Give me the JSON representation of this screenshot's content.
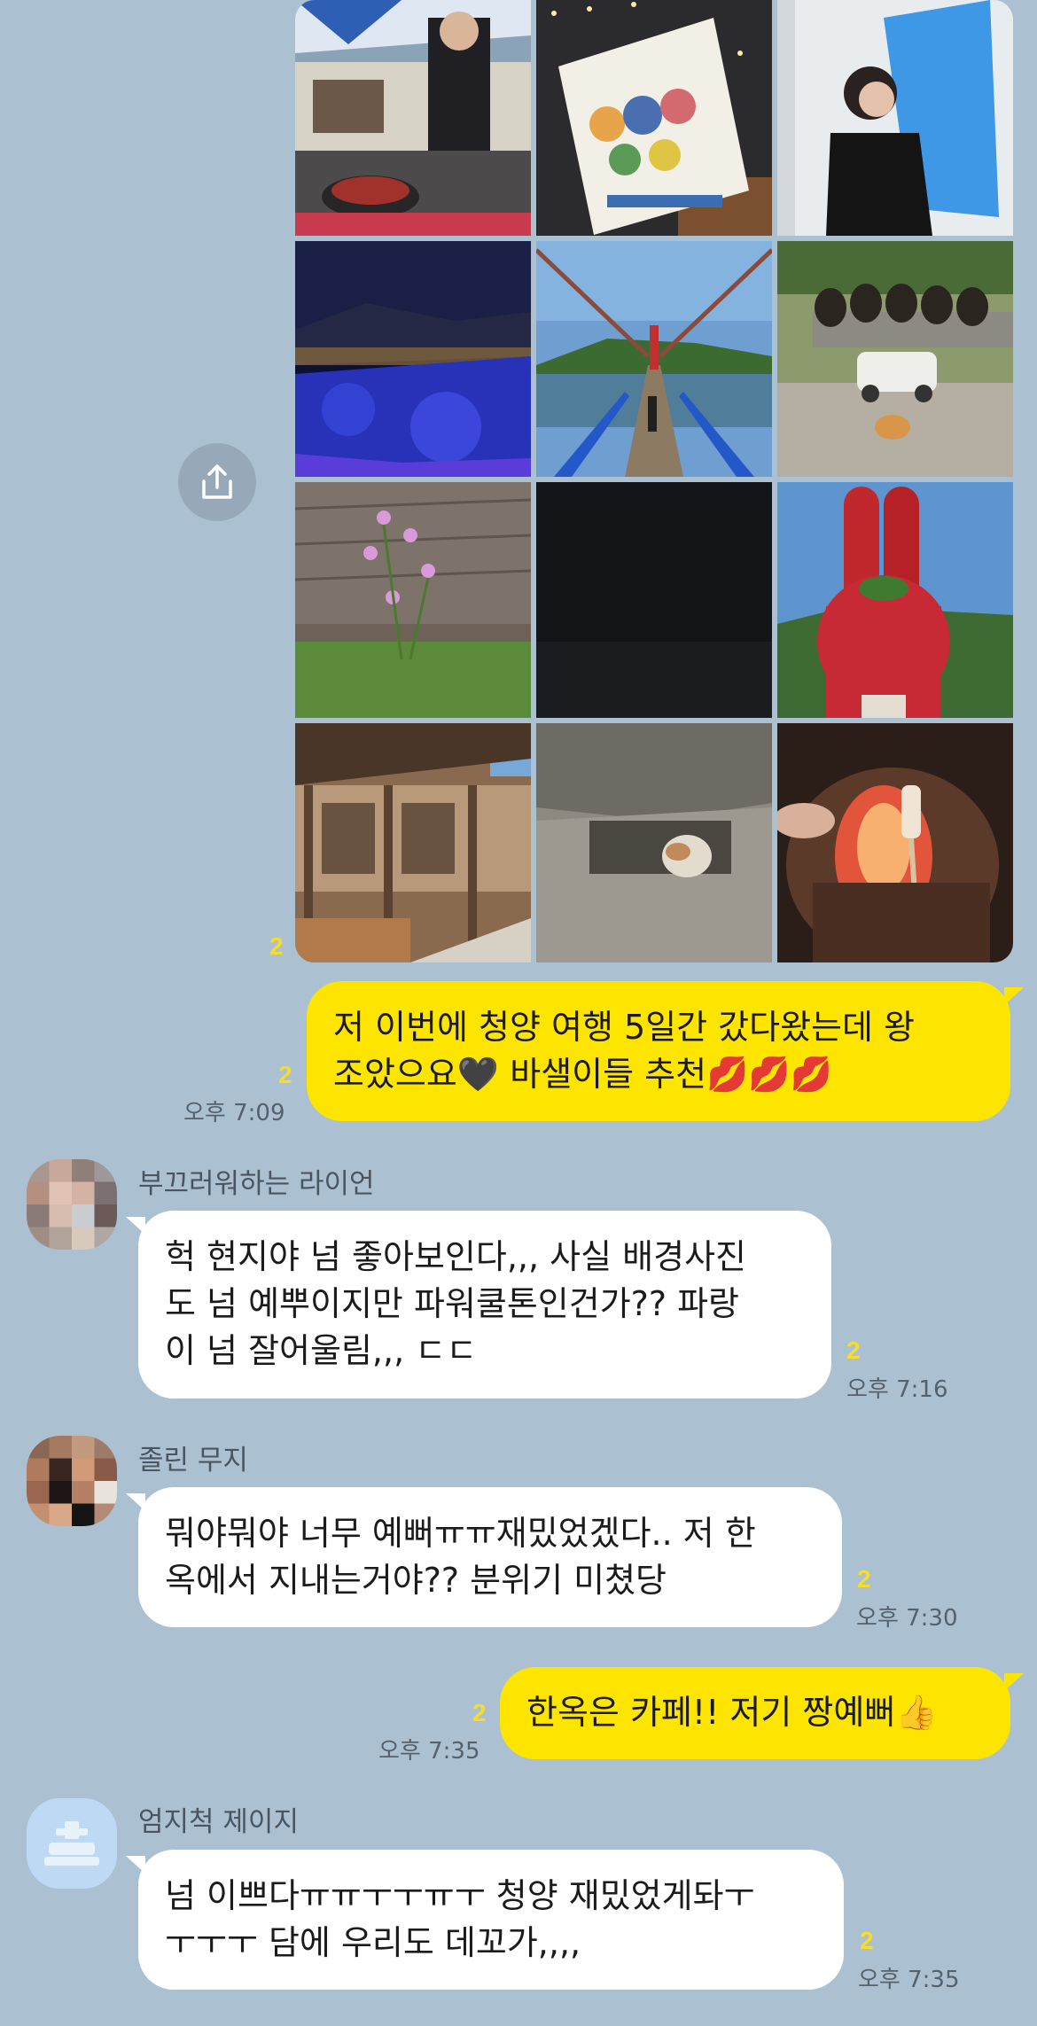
{
  "photo_album": {
    "unread": "2",
    "photos": [
      "camping-grill",
      "tiger-poster-drawing",
      "portrait-blue-backdrop",
      "night-city-blue-lights",
      "suspension-bridge",
      "jars-and-cat",
      "field-wildflowers",
      "dark-night-sky",
      "chili-pepper-statue",
      "hanok-house",
      "cat-under-rock",
      "campfire-marshmallow"
    ]
  },
  "messages": [
    {
      "side": "me",
      "lines": [
        "저 이번에 청양 여행 5일간 갔다왔는데 왕",
        "조았으요🖤 바샐이들 추천💋💋💋"
      ],
      "unread": "2",
      "time": "오후 7:09"
    },
    {
      "side": "other",
      "sender": "부끄러워하는 라이언",
      "lines": [
        "헉 현지야 넘 좋아보인다,,, 사실 배경사진",
        "도 넘 예뿌이지만 파워쿨톤인건가?? 파랑",
        "이 넘 잘어울림,,, ㄷㄷ"
      ],
      "unread": "2",
      "time": "오후 7:16"
    },
    {
      "side": "other",
      "sender": "졸린 무지",
      "lines": [
        "뭐야뭐야 너무 예뻐ㅠㅠ재밌었겠다.. 저 한",
        "옥에서 지내는거야?? 분위기 미쳤당"
      ],
      "unread": "2",
      "time": "오후 7:30"
    },
    {
      "side": "me",
      "lines": [
        "한옥은 카페!! 저기 짱예뻐👍"
      ],
      "unread": "2",
      "time": "오후 7:35"
    },
    {
      "side": "other",
      "sender": "엄지척 제이지",
      "lines": [
        "넘 이쁘다ㅠㅠㅜㅜㅠㅜ 청양 재밌었게돠ㅜ",
        "ㅜㅜㅜ 담에 우리도 데꼬가,,,,"
      ],
      "unread": "2",
      "time": "오후 7:35"
    }
  ],
  "icons": {
    "share": "share-upload-icon",
    "default_avatar": "person-silhouette-icon"
  },
  "colors": {
    "background": "#abc1d1",
    "my_bubble": "#fee500",
    "other_bubble": "#ffffff",
    "unread": "#f7dc2a"
  }
}
